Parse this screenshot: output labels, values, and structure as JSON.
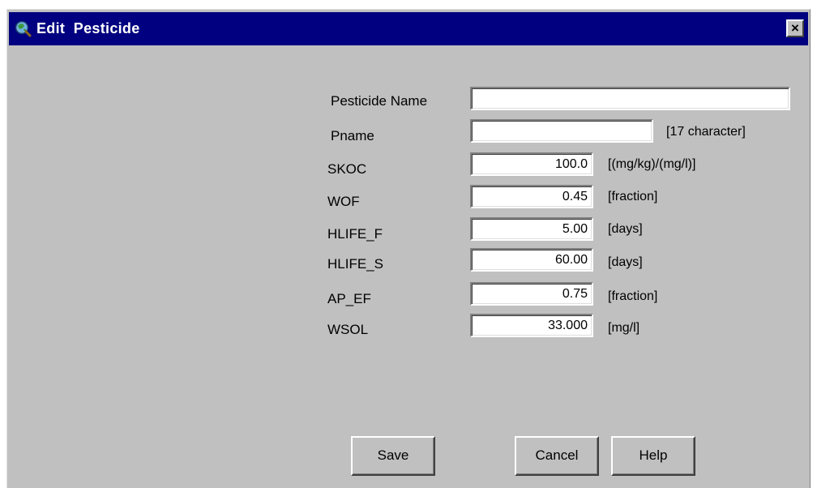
{
  "window": {
    "title": "Edit  Pesticide",
    "close_symbol": "×",
    "icon": "pesticide-app-icon"
  },
  "form": {
    "pesticide_name": {
      "label": "Pesticide Name",
      "value": ""
    },
    "pname": {
      "label": "Pname",
      "value": "",
      "unit": "[17 character]"
    },
    "skoc": {
      "label": "SKOC",
      "value": "100.0",
      "unit": "[(mg/kg)/(mg/l)]"
    },
    "wof": {
      "label": "WOF",
      "value": "0.45",
      "unit": "[fraction]"
    },
    "hlife_f": {
      "label": "HLIFE_F",
      "value": "5.00",
      "unit": "[days]"
    },
    "hlife_s": {
      "label": "HLIFE_S",
      "value": "60.00",
      "unit": "[days]"
    },
    "ap_ef": {
      "label": "AP_EF",
      "value": "0.75",
      "unit": "[fraction]"
    },
    "wsol": {
      "label": "WSOL",
      "value": "33.000",
      "unit": "[mg/l]"
    }
  },
  "buttons": {
    "save": "Save",
    "cancel": "Cancel",
    "help": "Help"
  },
  "colors": {
    "titlebar": "#000080",
    "face": "#c0c0c0",
    "field": "#ffffff"
  }
}
